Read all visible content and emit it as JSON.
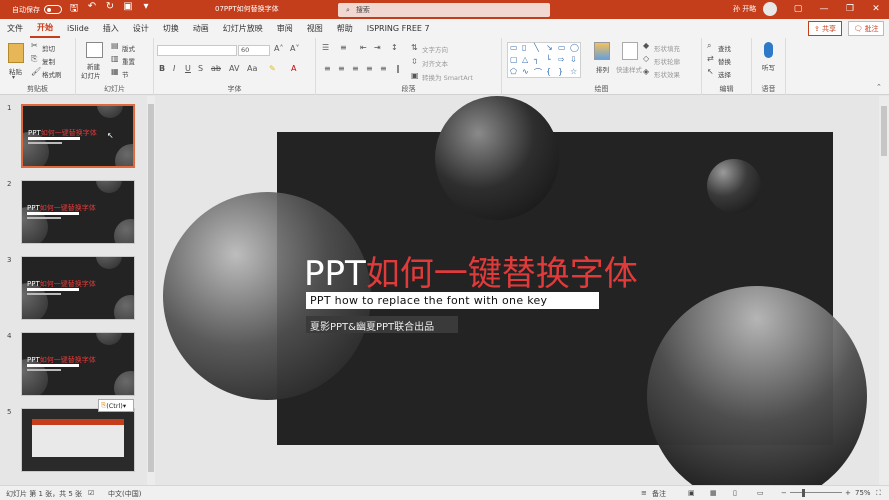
{
  "window": {
    "autosave_label": "自动保存",
    "autosave_state": "关",
    "document_title": "07PPT如何替换字体",
    "search_placeholder": "搜索",
    "user_name": "孙 开略"
  },
  "tabs": [
    "文件",
    "开始",
    "iSlide",
    "插入",
    "设计",
    "切换",
    "动画",
    "幻灯片放映",
    "审阅",
    "视图",
    "帮助",
    "ISPRING FREE 7"
  ],
  "active_tab": "开始",
  "share_label": "共享",
  "comment_label": "批注",
  "ribbon": {
    "clipboard": {
      "label": "剪贴板",
      "paste": "粘贴",
      "cut": "剪切",
      "copy": "复制",
      "format_painter": "格式刷"
    },
    "slides": {
      "label": "幻灯片",
      "new_slide": "新建",
      "new_slide_2": "幻灯片",
      "layout": "版式",
      "reset": "重置",
      "section": "节"
    },
    "font": {
      "label": "字体",
      "font_size": "60"
    },
    "paragraph": {
      "label": "段落",
      "text_direction": "文字方向",
      "align_text": "对齐文本",
      "smartart": "转换为 SmartArt"
    },
    "drawing": {
      "label": "绘图",
      "arrange": "排列",
      "quick_styles": "快速样式",
      "fill": "形状填充",
      "outline": "形状轮廓",
      "effects": "形状效果"
    },
    "editing": {
      "label": "编辑",
      "find": "查找",
      "replace": "替换",
      "select": "选择"
    },
    "voice": {
      "label": "语音",
      "dictate": "听写"
    }
  },
  "thumbnails": [
    {
      "number": "1",
      "title_white": "PPT",
      "title_red": "如何一键替换字体"
    },
    {
      "number": "2",
      "title_white": "PPT",
      "title_red": "如何一键替换字体"
    },
    {
      "number": "3",
      "title_white": "PPT",
      "title_red": "如何一键替换字体"
    },
    {
      "number": "4",
      "title_white": "PPT",
      "title_red": "如何一键替换字体"
    },
    {
      "number": "5"
    }
  ],
  "paste_options": "(Ctrl)",
  "slide": {
    "title_white": "PPT",
    "title_red": "如何一键替换字体",
    "subtitle": "PPT how to replace the font with one key",
    "credit": "夏影PPT&幽夏PPT联合出品"
  },
  "status": {
    "slide_info": "幻灯片 第 1 张，共 5 张",
    "language": "中文(中国)",
    "notes": "备注",
    "zoom": "75%"
  },
  "colors": {
    "accent": "#c43e1c",
    "title_red": "#e03a3a",
    "slide_bg": "#222222"
  }
}
